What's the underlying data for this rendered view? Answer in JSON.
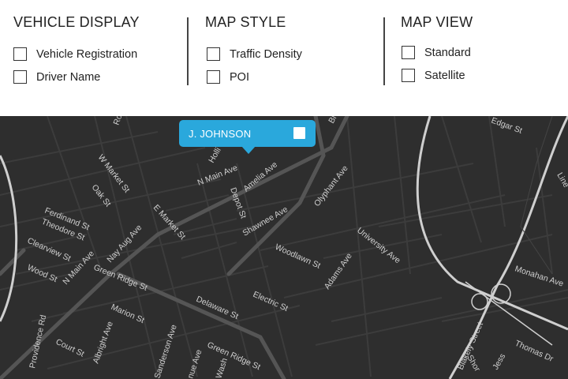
{
  "vehicle_display": {
    "title": "VEHICLE DISPLAY",
    "options": [
      {
        "label": "Vehicle Registration",
        "checked": false
      },
      {
        "label": "Driver Name",
        "checked": false
      }
    ]
  },
  "map_style": {
    "title": "MAP STYLE",
    "options": [
      {
        "label": "Traffic Density",
        "checked": false
      },
      {
        "label": "POI",
        "checked": false
      }
    ]
  },
  "map_view": {
    "title": "MAP VIEW",
    "options": [
      {
        "label": "Standard",
        "checked": false
      },
      {
        "label": "Satellite",
        "checked": false
      }
    ]
  },
  "vehicle_marker": {
    "label": "J. JOHNSON",
    "color": "#2aa8dc"
  },
  "map": {
    "background": "#2e2e2e",
    "streets": [
      "Roo",
      "Holli",
      "N Main Ave",
      "Amelia Ave",
      "Depot St",
      "Shawnee Ave",
      "Olyphant Ave",
      "Bl",
      "Edgar St",
      "W Market St",
      "Oak St",
      "Ferdinand St",
      "Theodore St",
      "E Market St",
      "Nay Aug Ave",
      "Clearview St",
      "Wood St",
      "N Main Ave",
      "Green Ridge St",
      "University Ave",
      "Woodlawn St",
      "Adams Ave",
      "Electric St",
      "Delaware St",
      "Marion St",
      "Monahan Ave",
      "Providence Rd",
      "Court St",
      "Albright Ave",
      "Sanderson Ave",
      "Green Ridge St",
      "Blakely Street",
      "Thomas Dr",
      "Jess",
      "Shor",
      "Wash",
      "nue Ave",
      "Line"
    ]
  }
}
